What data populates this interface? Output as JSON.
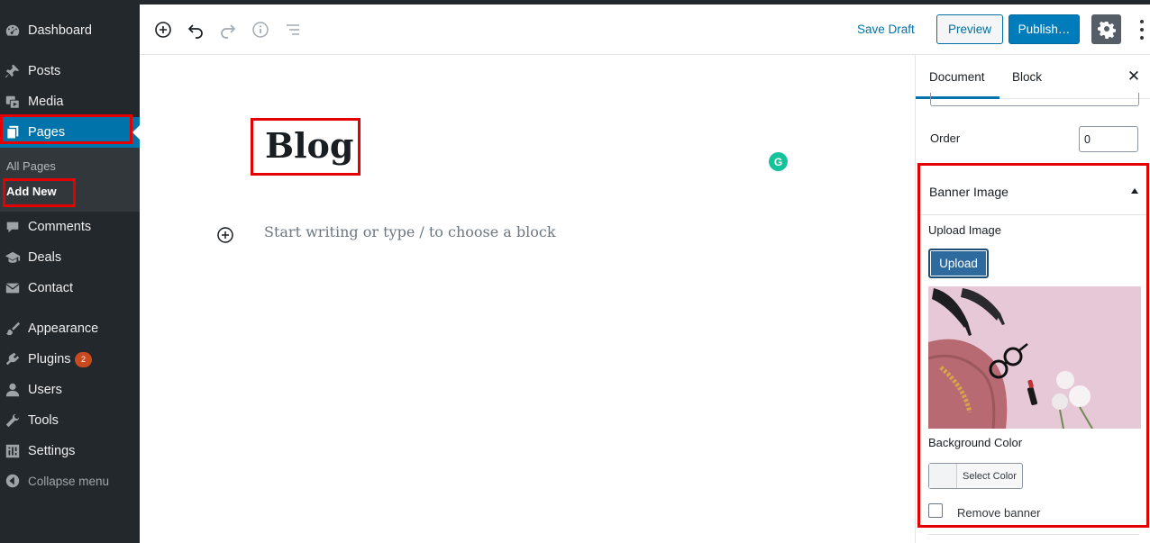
{
  "sidebar": {
    "items": [
      {
        "label": "Dashboard",
        "icon": "dashboard-icon"
      },
      {
        "label": "Posts",
        "icon": "pin-icon"
      },
      {
        "label": "Media",
        "icon": "media-icon"
      },
      {
        "label": "Pages",
        "icon": "pages-icon",
        "active": true
      },
      {
        "label": "Comments",
        "icon": "comment-icon"
      },
      {
        "label": "Deals",
        "icon": "graduation-cap-icon"
      },
      {
        "label": "Contact",
        "icon": "envelope-icon"
      },
      {
        "label": "Appearance",
        "icon": "brush-icon"
      },
      {
        "label": "Plugins",
        "icon": "plugin-icon",
        "badge": "2"
      },
      {
        "label": "Users",
        "icon": "user-icon"
      },
      {
        "label": "Tools",
        "icon": "wrench-icon"
      },
      {
        "label": "Settings",
        "icon": "settings-sliders-icon"
      },
      {
        "label": "Collapse menu",
        "icon": "collapse-arrow-icon"
      }
    ],
    "submenu": {
      "all_pages": "All Pages",
      "add_new": "Add New"
    }
  },
  "toolbar": {
    "icons": [
      "add-block-icon",
      "undo-icon",
      "redo-icon",
      "info-icon",
      "block-navigation-icon"
    ],
    "save_draft": "Save Draft",
    "preview": "Preview",
    "publish": "Publish…",
    "settings_icon": "gear-icon",
    "more_icon": "more-vertical-icon"
  },
  "editor": {
    "title": "Blog",
    "placeholder": "Start writing or type / to choose a block",
    "grammarly_letter": "G"
  },
  "panel": {
    "tabs": [
      "Document",
      "Block"
    ],
    "active_tab": "Document",
    "order_label": "Order",
    "order_value": "0",
    "banner": {
      "title": "Banner Image",
      "upload_label": "Upload Image",
      "upload_button": "Upload",
      "bg_color_label": "Background Color",
      "select_color": "Select Color",
      "remove_banner": "Remove banner",
      "remove_banner_checked": false
    }
  },
  "colors": {
    "admin_bar": "#23282d",
    "accent": "#0073aa",
    "highlight": "#e50000",
    "badge": "#ca4a1f"
  }
}
